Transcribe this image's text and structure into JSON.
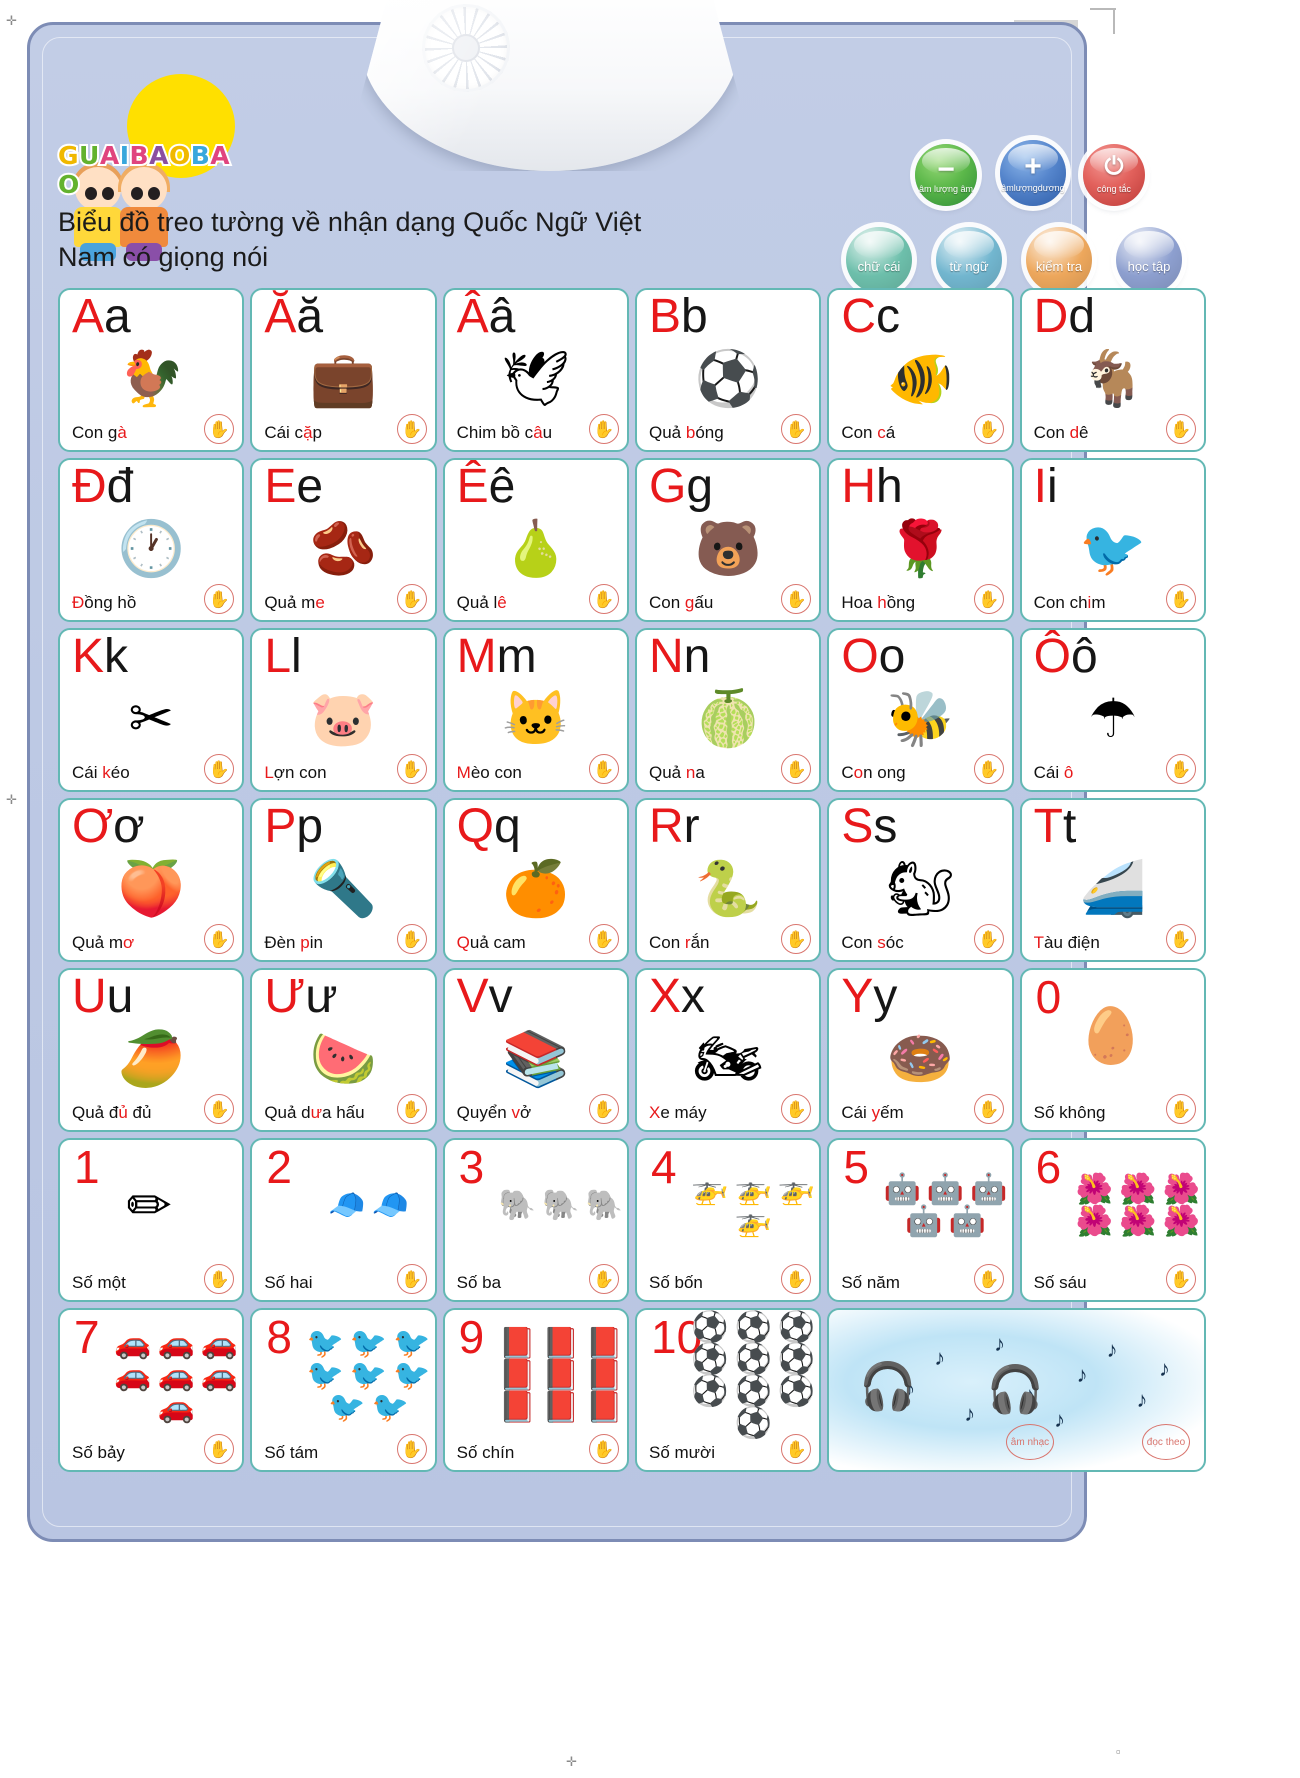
{
  "brand": {
    "logo_text": "GUAIBAOBAO",
    "logo_letters": [
      "G",
      "U",
      "A",
      "I",
      "B",
      "A",
      "O",
      "B",
      "A",
      "O"
    ],
    "logo_colors": [
      "#f0b800",
      "#63b22e",
      "#e0447e",
      "#39a7dc",
      "#e0447e",
      "#8b4fa0",
      "#f0b800",
      "#39a7dc",
      "#e0447e",
      "#63b22e"
    ]
  },
  "headline": "Biểu đồ treo tường về nhận dạng Quốc Ngữ Việt Nam có giọng nói",
  "controls": {
    "volume_down": {
      "label": "âm lượng âm",
      "symbol": "−",
      "color": "#5cb84a"
    },
    "volume_up": {
      "label": "âmlượngdương",
      "symbol": "+",
      "color": "#5585cc"
    },
    "power": {
      "label": "công tắc",
      "symbol": "⏻",
      "color": "#e2615c"
    },
    "modes": [
      {
        "label": "chữ cái",
        "color": "#6dbfab"
      },
      {
        "label": "từ ngữ",
        "color": "#72b6cf"
      },
      {
        "label": "kiểm tra",
        "color": "#eda75c"
      },
      {
        "label": "học tập",
        "color": "#8d9fcf"
      }
    ]
  },
  "hand_icon_name": "touch-hand-icon",
  "cells": [
    {
      "type": "letter",
      "upper": "A",
      "lower": "a",
      "caption": "Con gà",
      "hl": "à",
      "art": "🐓"
    },
    {
      "type": "letter",
      "upper": "Ă",
      "lower": "ă",
      "caption": "Cái cặp",
      "hl": "ặ",
      "art": "💼"
    },
    {
      "type": "letter",
      "upper": "Â",
      "lower": "â",
      "caption": "Chim bồ câu",
      "hl": "â",
      "art": "🕊"
    },
    {
      "type": "letter",
      "upper": "B",
      "lower": "b",
      "caption": "Quả bóng",
      "hl": "b",
      "art": "⚽"
    },
    {
      "type": "letter",
      "upper": "C",
      "lower": "c",
      "caption": "Con cá",
      "hl": "c",
      "art": "🐠"
    },
    {
      "type": "letter",
      "upper": "D",
      "lower": "d",
      "caption": "Con dê",
      "hl": "d",
      "art": "🐐"
    },
    {
      "type": "letter",
      "upper": "Đ",
      "lower": "đ",
      "caption": "Đồng hồ",
      "hl": "Đ",
      "art": "🕐"
    },
    {
      "type": "letter",
      "upper": "E",
      "lower": "e",
      "caption": "Quả me",
      "hl": "e",
      "art": "🫘"
    },
    {
      "type": "letter",
      "upper": "Ê",
      "lower": "ê",
      "caption": "Quả lê",
      "hl": "ê",
      "art": "🍐"
    },
    {
      "type": "letter",
      "upper": "G",
      "lower": "g",
      "caption": "Con gấu",
      "hl": "g",
      "art": "🐻"
    },
    {
      "type": "letter",
      "upper": "H",
      "lower": "h",
      "caption": "Hoa hồng",
      "hl": "h",
      "art": "🌹"
    },
    {
      "type": "letter",
      "upper": "I",
      "lower": "i",
      "caption": "Con chim",
      "hl": "i",
      "art": "🐦"
    },
    {
      "type": "letter",
      "upper": "K",
      "lower": "k",
      "caption": "Cái kéo",
      "hl": "k",
      "art": "✂"
    },
    {
      "type": "letter",
      "upper": "L",
      "lower": "l",
      "caption": "Lợn con",
      "hl": "L",
      "art": "🐷"
    },
    {
      "type": "letter",
      "upper": "M",
      "lower": "m",
      "caption": "Mèo con",
      "hl": "M",
      "art": "🐱"
    },
    {
      "type": "letter",
      "upper": "N",
      "lower": "n",
      "caption": "Quả na",
      "hl": "n",
      "art": "🍈"
    },
    {
      "type": "letter",
      "upper": "O",
      "lower": "o",
      "caption": "Con ong",
      "hl": "o",
      "art": "🐝"
    },
    {
      "type": "letter",
      "upper": "Ô",
      "lower": "ô",
      "caption": "Cái ô",
      "hl": "ô",
      "art": "☂"
    },
    {
      "type": "letter",
      "upper": "Ơ",
      "lower": "ơ",
      "caption": "Quả mơ",
      "hl": "ơ",
      "art": "🍑"
    },
    {
      "type": "letter",
      "upper": "P",
      "lower": "p",
      "caption": "Đèn pin",
      "hl": "p",
      "art": "🔦"
    },
    {
      "type": "letter",
      "upper": "Q",
      "lower": "q",
      "caption": "Quả cam",
      "hl": "Q",
      "art": "🍊"
    },
    {
      "type": "letter",
      "upper": "R",
      "lower": "r",
      "caption": "Con rắn",
      "hl": "r",
      "art": "🐍"
    },
    {
      "type": "letter",
      "upper": "S",
      "lower": "s",
      "caption": "Con sóc",
      "hl": "s",
      "art": "🐿"
    },
    {
      "type": "letter",
      "upper": "T",
      "lower": "t",
      "caption": "Tàu điện",
      "hl": "T",
      "art": "🚄"
    },
    {
      "type": "letter",
      "upper": "U",
      "lower": "u",
      "caption": "Quả đủ đủ",
      "hl": "ủ",
      "art": "🥭"
    },
    {
      "type": "letter",
      "upper": "Ư",
      "lower": "ư",
      "caption": "Quả dưa hấu",
      "hl": "ư",
      "art": "🍉"
    },
    {
      "type": "letter",
      "upper": "V",
      "lower": "v",
      "caption": "Quyển vở",
      "hl": "v",
      "art": "📚"
    },
    {
      "type": "letter",
      "upper": "X",
      "lower": "x",
      "caption": "Xe máy",
      "hl": "X",
      "art": "🏍"
    },
    {
      "type": "letter",
      "upper": "Y",
      "lower": "y",
      "caption": "Cái yếm",
      "hl": "y",
      "art": "🍩"
    },
    {
      "type": "number",
      "num": "0",
      "caption": "Số không",
      "art": "🥚",
      "count": 1
    },
    {
      "type": "number",
      "num": "1",
      "caption": "Số một",
      "art": "✏",
      "count": 1
    },
    {
      "type": "number",
      "num": "2",
      "caption": "Số hai",
      "art": "🧢",
      "count": 2
    },
    {
      "type": "number",
      "num": "3",
      "caption": "Số ba",
      "art": "🐘",
      "count": 3
    },
    {
      "type": "number",
      "num": "4",
      "caption": "Số bốn",
      "art": "🚁",
      "count": 4
    },
    {
      "type": "number",
      "num": "5",
      "caption": "Số năm",
      "art": "🤖",
      "count": 5
    },
    {
      "type": "number",
      "num": "6",
      "caption": "Số sáu",
      "art": "🌺",
      "count": 6
    },
    {
      "type": "number",
      "num": "7",
      "caption": "Số bảy",
      "art": "🚗",
      "count": 7
    },
    {
      "type": "number",
      "num": "8",
      "caption": "Số tám",
      "art": "🐦",
      "count": 8
    },
    {
      "type": "number",
      "num": "9",
      "caption": "Số chín",
      "art": "📕",
      "count": 9
    },
    {
      "type": "number",
      "num": "10",
      "caption": "Số mười",
      "art": "⚽",
      "count": 10
    },
    {
      "type": "music",
      "tags": [
        "âm nhạc",
        "đọc theo"
      ]
    }
  ]
}
